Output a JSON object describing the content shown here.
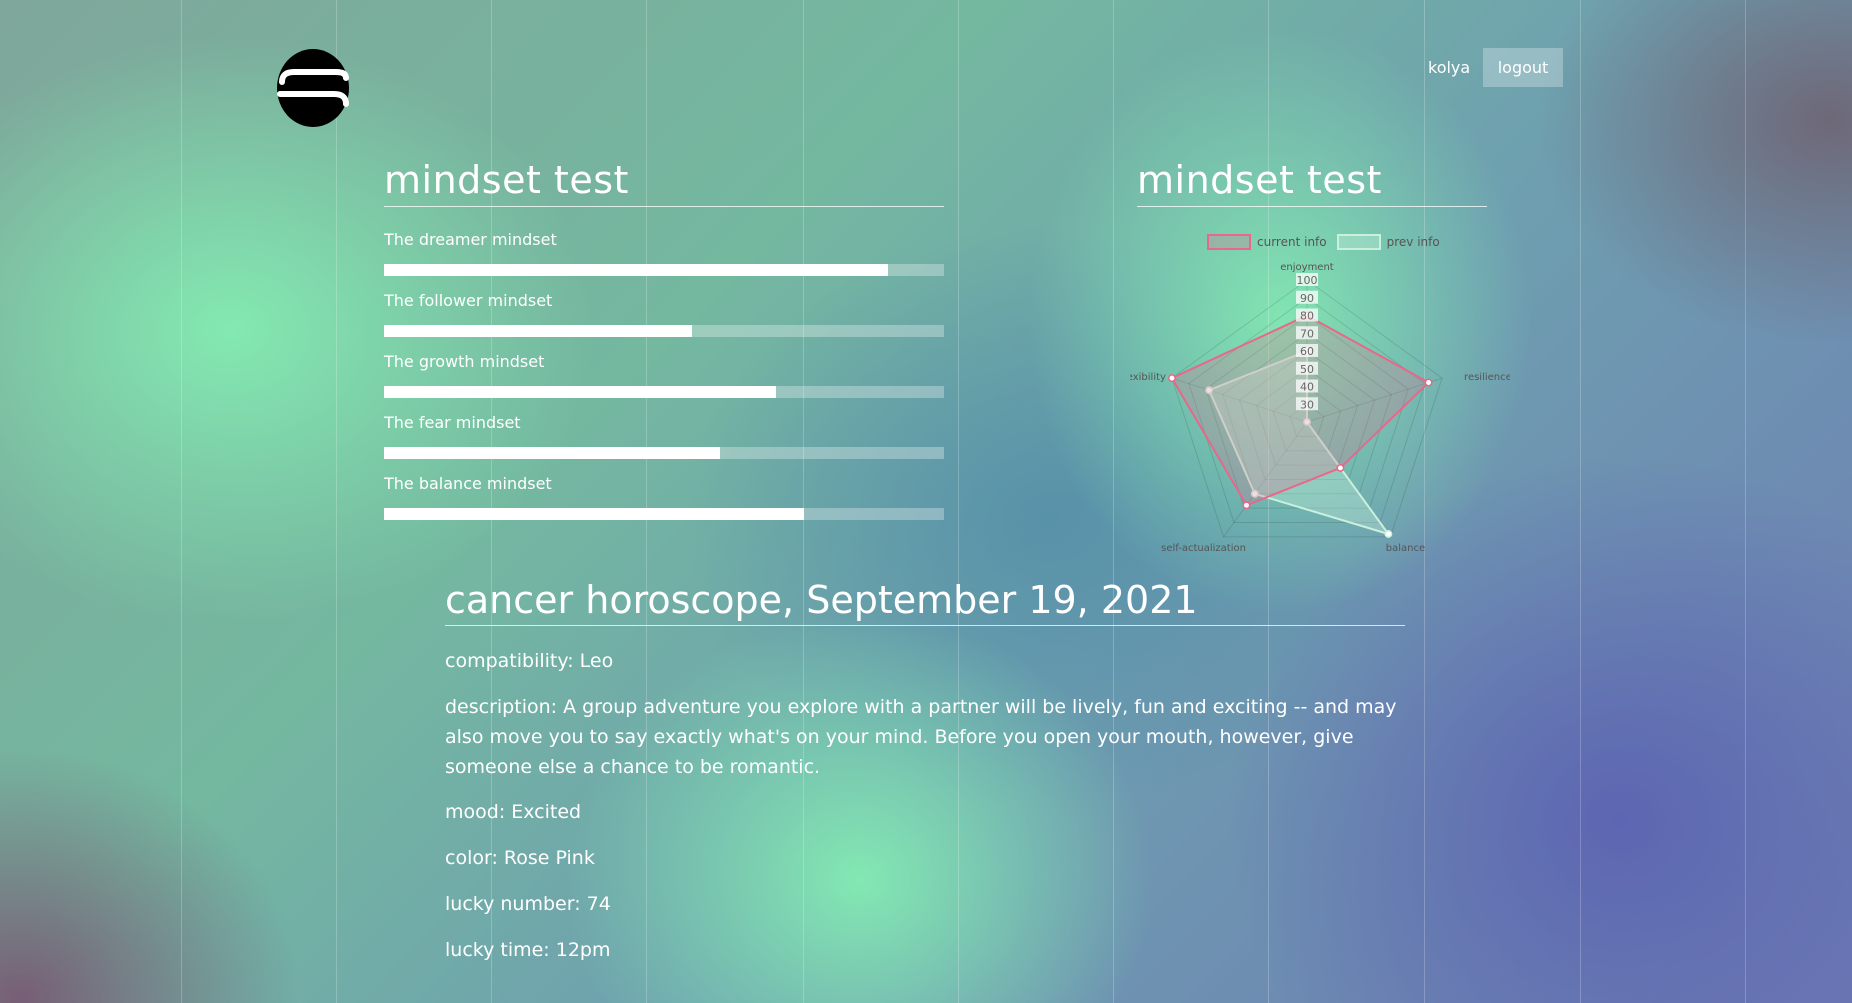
{
  "header": {
    "logo_icon": "s-logo-icon",
    "username": "kolya",
    "logout_label": "logout"
  },
  "mindset_bars": {
    "title": "mindset test",
    "items": [
      {
        "label": "The dreamer mindset",
        "value": 0.9
      },
      {
        "label": "The follower mindset",
        "value": 0.55
      },
      {
        "label": "The growth mindset",
        "value": 0.7
      },
      {
        "label": "The fear mindset",
        "value": 0.6
      },
      {
        "label": "The balance mindset",
        "value": 0.75
      }
    ]
  },
  "mindset_radar": {
    "title": "mindset test",
    "legend": [
      {
        "label": "current info",
        "border": "#e8678a",
        "fill": "rgba(232,103,138,0.25)"
      },
      {
        "label": "prev info",
        "border": "#c9f0dc",
        "fill": "rgba(201,240,220,0.35)"
      }
    ]
  },
  "chart_data": {
    "type": "radar",
    "axes": [
      "enjoyment",
      "resilience",
      "balance",
      "self-actualization",
      "flexibility"
    ],
    "r_ticks": [
      "30",
      "40",
      "50",
      "60",
      "70",
      "80",
      "90",
      "100"
    ],
    "rlim": [
      20,
      100
    ],
    "series": [
      {
        "name": "current info",
        "values": [
          80,
          92,
          52,
          78,
          100
        ],
        "color": "#e8678a"
      },
      {
        "name": "prev info",
        "values": [
          60,
          20,
          98,
          70,
          78
        ],
        "color": "#cfeee0"
      }
    ]
  },
  "horoscope": {
    "title": "cancer horoscope, September 19, 2021",
    "compatibility": "compatibility: Leo",
    "description": "description: A group adventure you explore with a partner will be lively, fun and exciting -- and may also move you to say exactly what's on your mind. Before you open your mouth, however, give someone else a chance to be romantic.",
    "mood": "mood: Excited",
    "color": "color: Rose Pink",
    "lucky_number": "lucky number: 74",
    "lucky_time": "lucky time: 12pm"
  }
}
